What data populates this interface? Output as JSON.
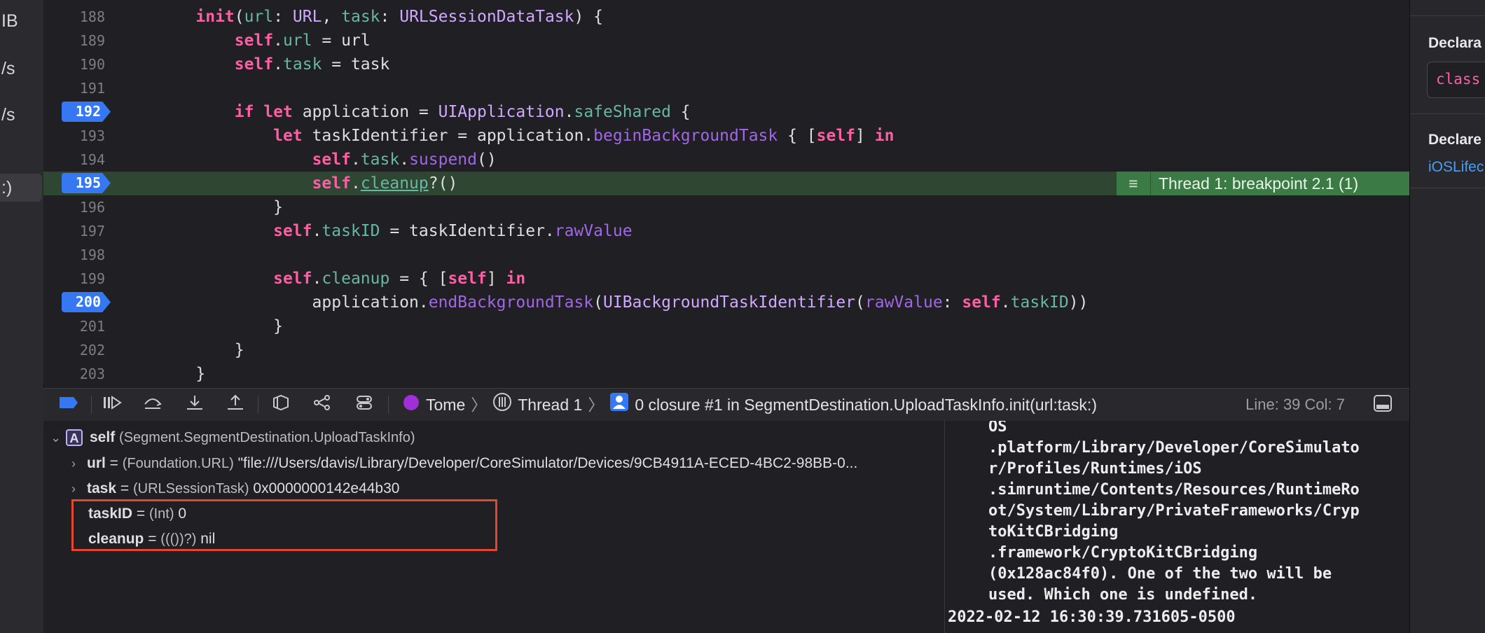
{
  "sidebar": {
    "items": [
      {
        "label": "IB"
      },
      {
        "label": "/s"
      },
      {
        "label": "/s"
      },
      {
        "label": ":)"
      }
    ]
  },
  "editor": {
    "lines": [
      {
        "num": "188",
        "breakpoint": false
      },
      {
        "num": "189",
        "breakpoint": false
      },
      {
        "num": "190",
        "breakpoint": false
      },
      {
        "num": "191",
        "breakpoint": false
      },
      {
        "num": "192",
        "breakpoint": true
      },
      {
        "num": "193",
        "breakpoint": false
      },
      {
        "num": "194",
        "breakpoint": false
      },
      {
        "num": "195",
        "breakpoint": true,
        "current": true
      },
      {
        "num": "196",
        "breakpoint": false
      },
      {
        "num": "197",
        "breakpoint": false
      },
      {
        "num": "198",
        "breakpoint": false
      },
      {
        "num": "199",
        "breakpoint": false
      },
      {
        "num": "200",
        "breakpoint": true
      },
      {
        "num": "201",
        "breakpoint": false
      },
      {
        "num": "202",
        "breakpoint": false
      },
      {
        "num": "203",
        "breakpoint": false
      }
    ],
    "thread_annotation": "Thread 1: breakpoint 2.1 (1)"
  },
  "debug_bar": {
    "target": "Tome",
    "thread": "Thread 1",
    "frame": "0 closure #1 in SegmentDestination.UploadTaskInfo.init(url:task:)",
    "line_col": "Line: 39  Col: 7"
  },
  "variables": {
    "self": {
      "name": "self",
      "type": "(Segment.SegmentDestination.UploadTaskInfo)"
    },
    "rows": [
      {
        "name": "url",
        "type": "(Foundation.URL)",
        "value": "\"file:///Users/davis/Library/Developer/CoreSimulator/Devices/9CB4911A-ECED-4BC2-98BB-0...",
        "expandable": true
      },
      {
        "name": "task",
        "type": "(URLSessionTask)",
        "value": "0x0000000142e44b30",
        "expandable": true
      },
      {
        "name": "taskID",
        "type": "(Int)",
        "value": "0",
        "expandable": false
      },
      {
        "name": "cleanup",
        "type": "((())?)",
        "value": "nil",
        "expandable": false
      }
    ]
  },
  "console": {
    "lines": [
      "OS",
      ".platform/Library/Developer/CoreSimulato",
      "r/Profiles/Runtimes/iOS",
      ".simruntime/Contents/Resources/RuntimeRo",
      "ot/System/Library/PrivateFrameworks/Cryp",
      "toKitCBridging",
      ".framework/CryptoKitCBridging",
      "(0x128ac84f0). One of the two will be",
      "used. Which one is undefined.",
      "2022-02-12 16:30:39.731605-0500"
    ]
  },
  "inspector": {
    "heading1": "Declara",
    "class_text": "class",
    "heading2": "Declare",
    "link": "iOSLifec"
  },
  "colors": {
    "breakpoint": "#3678f4",
    "current_line": "#2e4632",
    "thread_tag": "#3b7a44",
    "highlight_box": "#e5462e",
    "keyword": "#fc5fa3"
  }
}
